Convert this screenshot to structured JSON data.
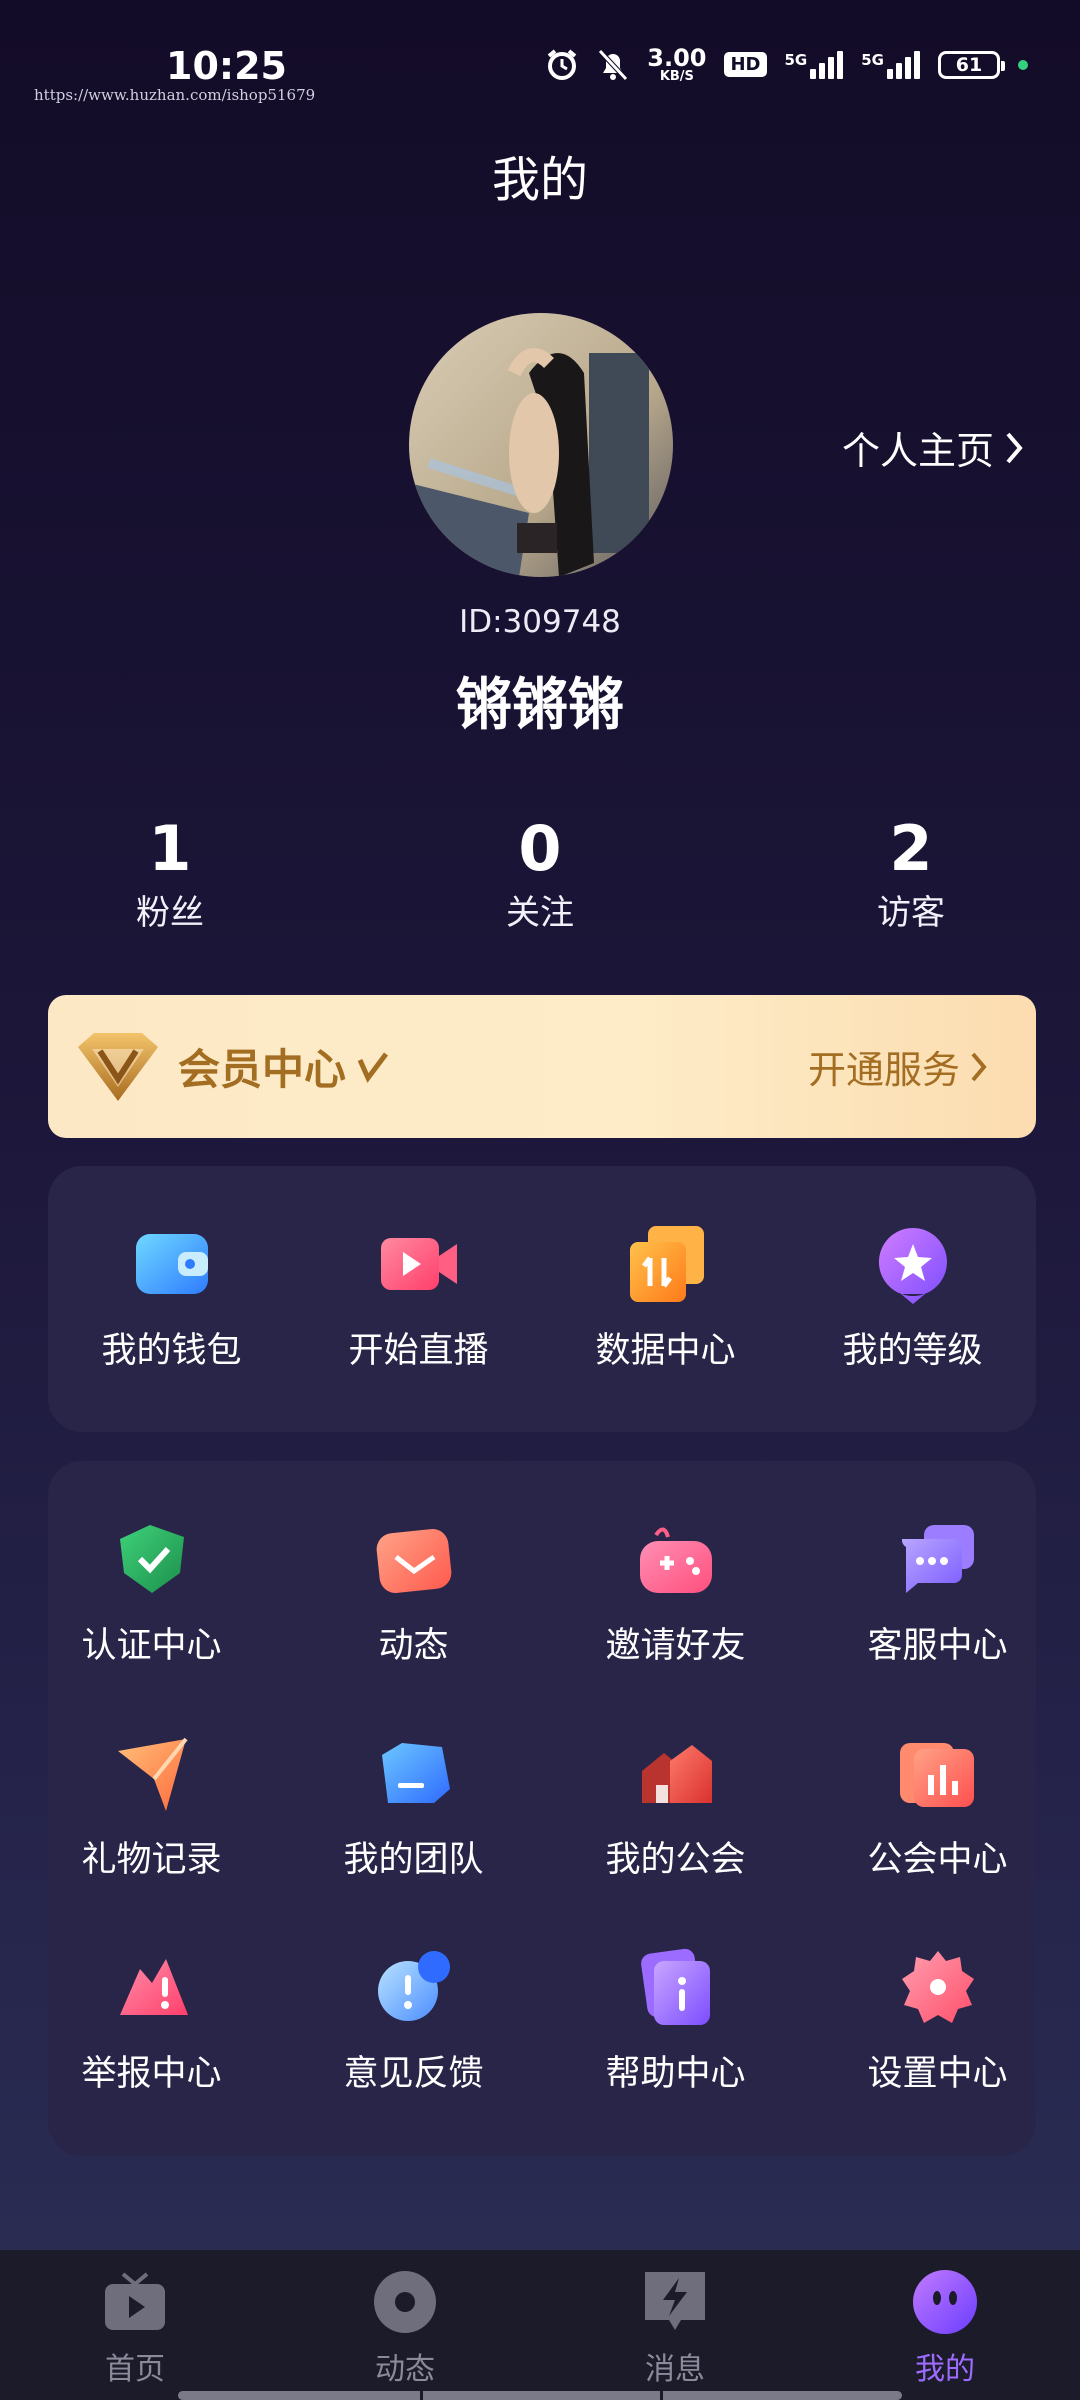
{
  "status_bar": {
    "time": "10:25",
    "watermark_url": "https://www.huzhan.com/ishop51679",
    "speed_value": "3.00",
    "speed_unit": "KB/S",
    "hd_label": "HD",
    "net1_label": "5G",
    "net2_label": "5G",
    "battery": "61",
    "icons": [
      "alarm-icon",
      "mute-bell-icon",
      "signal-icon"
    ]
  },
  "header": {
    "title": "我的"
  },
  "profile": {
    "home_link_label": "个人主页",
    "id_text": "ID:309748",
    "username": "锵锵锵"
  },
  "stats": [
    {
      "value": "1",
      "label": "粉丝"
    },
    {
      "value": "0",
      "label": "关注"
    },
    {
      "value": "2",
      "label": "访客"
    }
  ],
  "vip": {
    "title": "会员中心",
    "action_label": "开通服务",
    "color": "#a36d22"
  },
  "quick_actions": [
    {
      "label": "我的钱包",
      "icon": "wallet-icon"
    },
    {
      "label": "开始直播",
      "icon": "live-camera-icon"
    },
    {
      "label": "数据中心",
      "icon": "data-center-icon"
    },
    {
      "label": "我的等级",
      "icon": "level-star-icon"
    }
  ],
  "services": [
    {
      "label": "认证中心",
      "icon": "verify-shield-icon"
    },
    {
      "label": "动态",
      "icon": "moments-envelope-icon"
    },
    {
      "label": "邀请好友",
      "icon": "invite-gamepad-icon"
    },
    {
      "label": "客服中心",
      "icon": "customer-service-chat-icon"
    },
    {
      "label": "礼物记录",
      "icon": "gift-paper-plane-icon"
    },
    {
      "label": "我的团队",
      "icon": "team-folder-icon"
    },
    {
      "label": "我的公会",
      "icon": "guild-house-icon"
    },
    {
      "label": "公会中心",
      "icon": "guild-chart-icon"
    },
    {
      "label": "举报中心",
      "icon": "report-warning-icon"
    },
    {
      "label": "意见反馈",
      "icon": "feedback-bubble-icon"
    },
    {
      "label": "帮助中心",
      "icon": "help-info-icon"
    },
    {
      "label": "设置中心",
      "icon": "settings-gear-icon"
    }
  ],
  "bottom_nav": [
    {
      "label": "首页",
      "icon": "tv-home-icon"
    },
    {
      "label": "动态",
      "icon": "moments-circle-icon"
    },
    {
      "label": "消息",
      "icon": "message-bolt-icon"
    },
    {
      "label": "我的",
      "icon": "profile-face-icon",
      "active": true
    }
  ],
  "colors": {
    "accent": "#9d6bff",
    "background": "#1b1537",
    "panel": "#292549",
    "vip_bg": "#fde8c6"
  }
}
